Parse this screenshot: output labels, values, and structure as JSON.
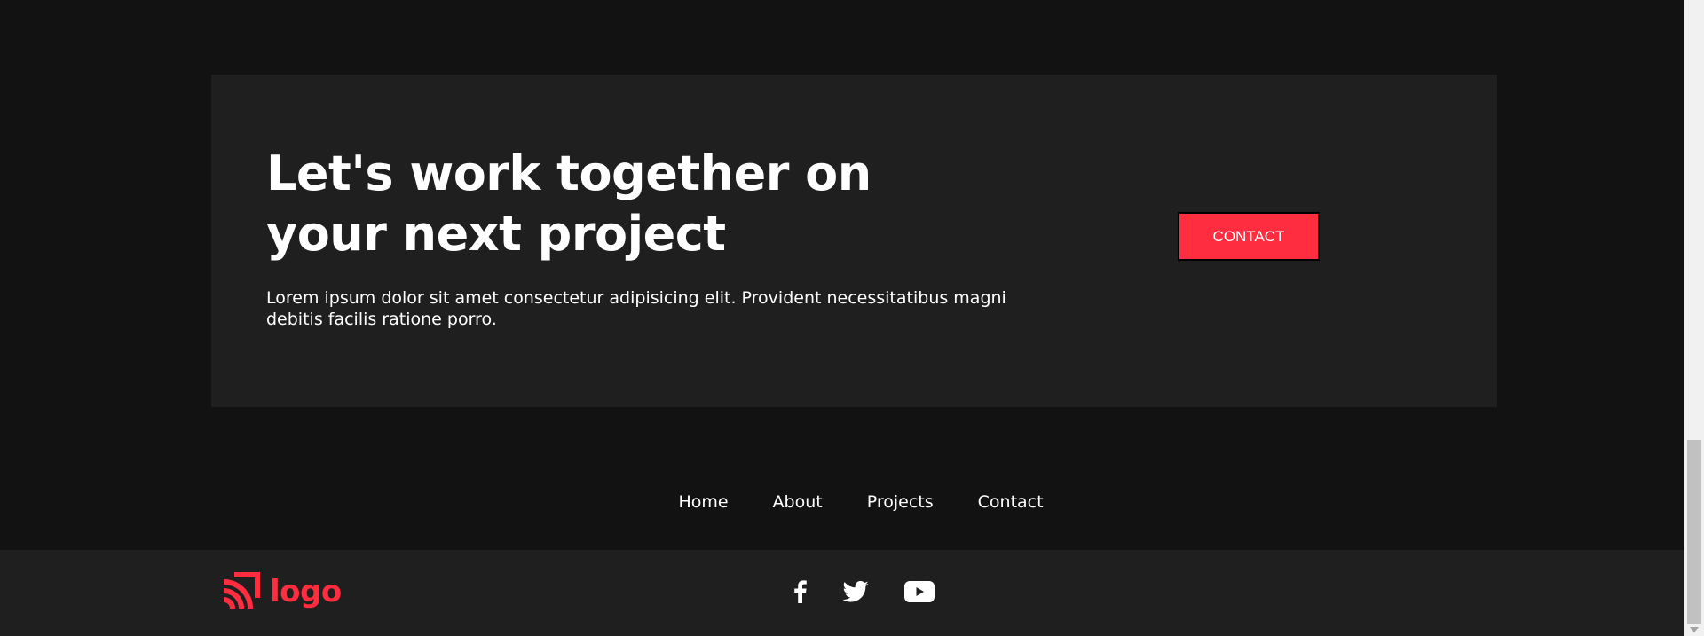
{
  "cta": {
    "title": "Let's work together on your next project",
    "description": "Lorem ipsum dolor sit amet consectetur adipisicing elit. Provident necessitatibus magni debitis facilis ratione porro.",
    "button_label": "CONTACT"
  },
  "nav": {
    "items": [
      {
        "label": "Home"
      },
      {
        "label": "About"
      },
      {
        "label": "Projects"
      },
      {
        "label": "Contact"
      }
    ]
  },
  "footer": {
    "logo_text": "logo",
    "socials": [
      "facebook-icon",
      "twitter-icon",
      "youtube-icon"
    ]
  },
  "colors": {
    "background": "#121212",
    "card": "#1f1f1f",
    "accent": "#ff2d3f",
    "text": "#ffffff"
  }
}
